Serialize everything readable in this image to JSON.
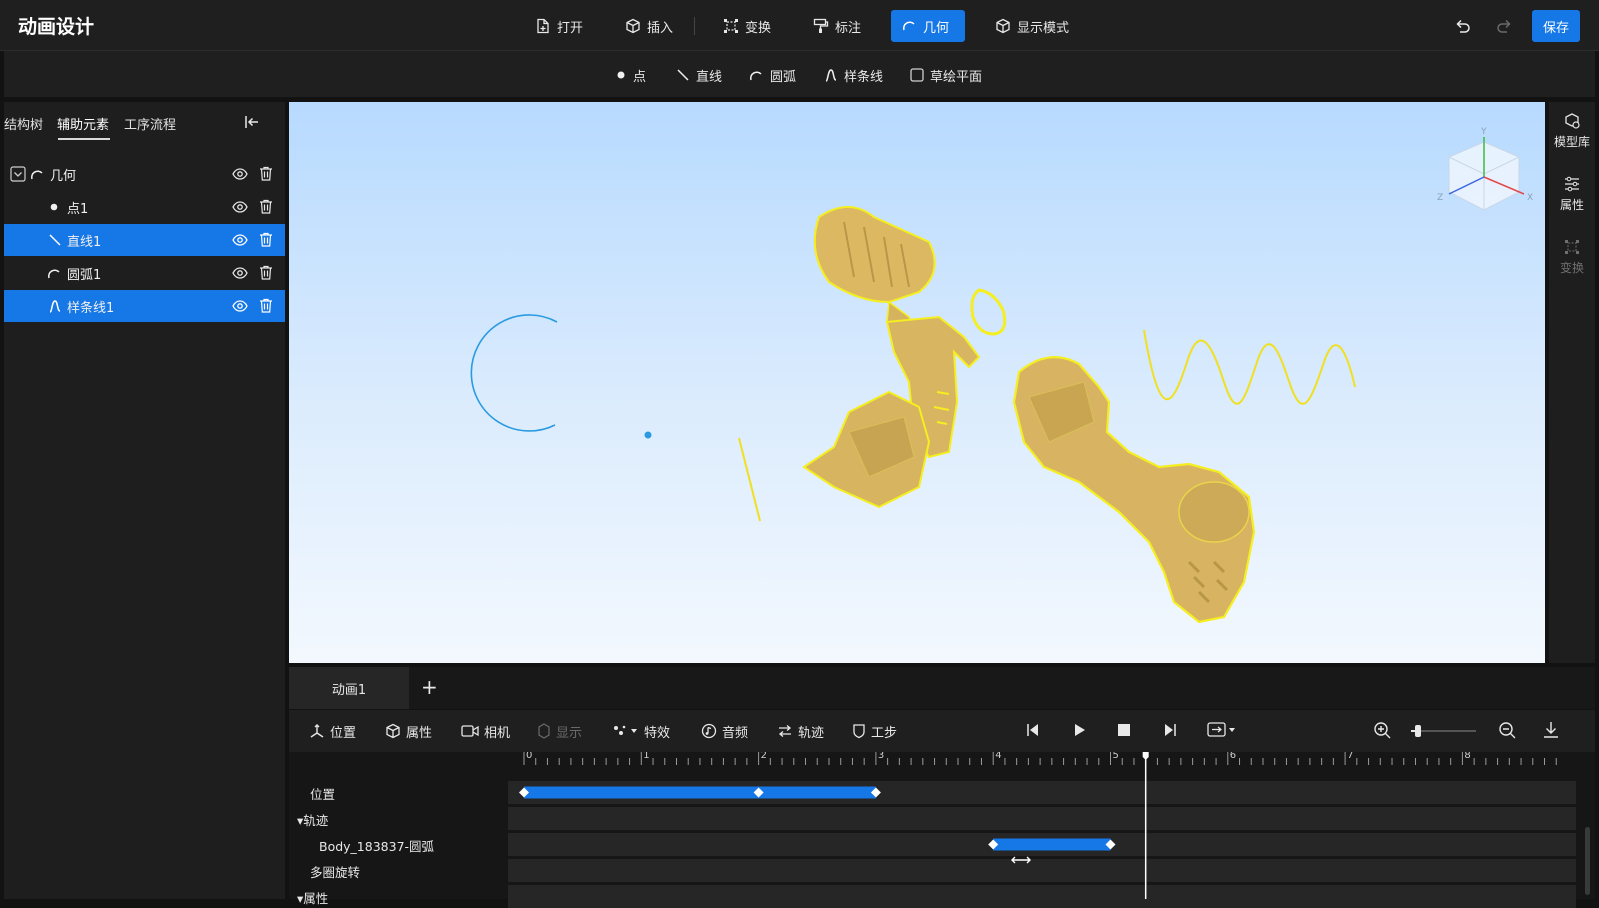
{
  "app": {
    "title": "动画设计"
  },
  "toolbar": {
    "items": [
      {
        "label": "打开",
        "icon": "file-open-icon"
      },
      {
        "label": "插入",
        "icon": "cube-insert-icon"
      },
      {
        "label": "变换",
        "icon": "transform-icon"
      },
      {
        "label": "标注",
        "icon": "annotate-brush-icon"
      },
      {
        "label": "几何",
        "icon": "arc-geometry-icon",
        "active": true
      },
      {
        "label": "显示模式",
        "icon": "display-mode-icon"
      }
    ],
    "save": "保存"
  },
  "geometry_bar": {
    "items": [
      {
        "label": "点",
        "icon": "dot-icon"
      },
      {
        "label": "直线",
        "icon": "line-icon"
      },
      {
        "label": "圆弧",
        "icon": "arc-icon"
      },
      {
        "label": "样条线",
        "icon": "spline-icon"
      },
      {
        "label": "草绘平面",
        "icon": "checkbox-icon"
      }
    ]
  },
  "left_panel": {
    "tabs": [
      "结构树",
      "辅助元素",
      "工序流程"
    ],
    "active_tab": "辅助元素",
    "tree": [
      {
        "label": "几何",
        "selected": false
      },
      {
        "label": "点1",
        "selected": false
      },
      {
        "label": "直线1",
        "selected": true
      },
      {
        "label": "圆弧1",
        "selected": false
      },
      {
        "label": "样条线1",
        "selected": true
      }
    ]
  },
  "right_rail": {
    "items": [
      "模型库",
      "属性",
      "变换"
    ]
  },
  "viewport": {
    "axis_labels": {
      "x": "X",
      "y": "Y",
      "z": "Z"
    }
  },
  "timeline": {
    "tabs": [
      "动画1"
    ],
    "add_tab": "+",
    "tools": [
      {
        "label": "位置",
        "icon": "position-axis-icon"
      },
      {
        "label": "属性",
        "icon": "property-cube-icon"
      },
      {
        "label": "相机",
        "icon": "camera-icon"
      },
      {
        "label": "显示",
        "icon": "display-icon",
        "disabled": true
      },
      {
        "label": "特效",
        "icon": "effects-icon"
      },
      {
        "label": "音频",
        "icon": "audio-icon"
      },
      {
        "label": "轨迹",
        "icon": "trajectory-icon"
      },
      {
        "label": "工步",
        "icon": "shield-step-icon"
      }
    ],
    "ruler_labels": [
      "0",
      "1",
      "2",
      "3",
      "4",
      "5",
      "6",
      "7",
      "8"
    ],
    "tracks": [
      {
        "label": "位置",
        "keyframes": [
          0,
          2,
          3
        ],
        "bar": [
          0,
          3
        ]
      },
      {
        "label": "▾轨迹"
      },
      {
        "label": "Body_183837-圆弧",
        "keyframes": [
          4,
          5
        ],
        "bar": [
          4,
          5
        ]
      },
      {
        "label": "多圈旋转"
      },
      {
        "label": "▾属性"
      }
    ],
    "playhead": 5.3
  }
}
